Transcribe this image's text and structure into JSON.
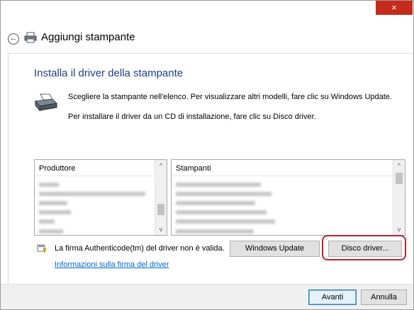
{
  "window": {
    "title": "Aggiungi stampante",
    "close_glyph": "×",
    "back_glyph": "←"
  },
  "main": {
    "heading": "Installa il driver della stampante",
    "desc_line1": "Scegliere la stampante nell'elenco. Per visualizzare altri modelli, fare clic su Windows Update.",
    "desc_line2": "Per installare il driver da un CD di installazione, fare clic su Disco driver."
  },
  "lists": {
    "manufacturer_header": "Produttore",
    "printers_header": "Stampanti"
  },
  "signature": {
    "text": "La firma Authenticode(tm) del driver non è valida.",
    "link": "Informazioni sulla firma del driver"
  },
  "buttons": {
    "windows_update": "Windows Update",
    "disk_driver": "Disco driver...",
    "next": "Avanti",
    "cancel": "Annulla"
  },
  "scroll": {
    "up": "^",
    "down": "v"
  },
  "icons": {
    "close": "close-icon",
    "back": "back-arrow-icon",
    "printer": "printer-icon",
    "warning": "warning-shield-icon"
  },
  "colors": {
    "heading": "#1e3f8a",
    "link": "#0066cc",
    "close_button": "#c42b1c",
    "highlight": "#c0202e",
    "footer": "#f0f0f0"
  }
}
